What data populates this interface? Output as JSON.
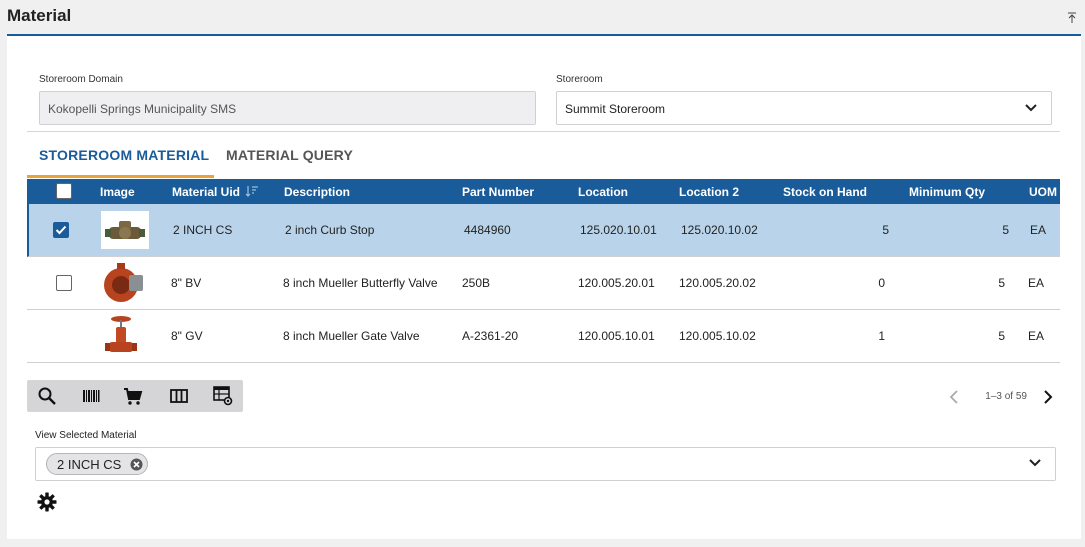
{
  "header": {
    "title": "Material"
  },
  "filters": {
    "domain_label": "Storeroom Domain",
    "domain_value": "Kokopelli Springs Municipality SMS",
    "storeroom_label": "Storeroom",
    "storeroom_value": "Summit Storeroom"
  },
  "tabs": [
    {
      "label": "STOREROOM MATERIAL",
      "active": true
    },
    {
      "label": "MATERIAL QUERY",
      "active": false
    }
  ],
  "table": {
    "columns": [
      "Image",
      "Material Uid",
      "Description",
      "Part Number",
      "Location",
      "Location 2",
      "Stock on Hand",
      "Minimum Qty",
      "UOM"
    ],
    "rows": [
      {
        "checked": true,
        "uid": "2 INCH CS",
        "description": "2 inch Curb Stop",
        "part_number": "4484960",
        "location": "125.020.10.01",
        "location2": "125.020.10.02",
        "stock": "5",
        "min_qty": "5",
        "uom": "EA",
        "image": "curb-stop"
      },
      {
        "checked": false,
        "uid": "8\" BV",
        "description": "8 inch Mueller Butterfly Valve",
        "part_number": "250B",
        "location": "120.005.20.01",
        "location2": "120.005.20.02",
        "stock": "0",
        "min_qty": "5",
        "uom": "EA",
        "image": "butterfly-valve"
      },
      {
        "checked": false,
        "uid": "8\" GV",
        "description": "8 inch Mueller Gate Valve",
        "part_number": "A-2361-20",
        "location": "120.005.10.01",
        "location2": "120.005.10.02",
        "stock": "1",
        "min_qty": "5",
        "uom": "EA",
        "image": "gate-valve"
      }
    ]
  },
  "toolbar": {
    "icons": [
      "search-icon",
      "barcode-icon",
      "cart-icon",
      "columns-icon",
      "table-settings-icon"
    ]
  },
  "pagination": {
    "text": "1–3 of 59"
  },
  "selected_material": {
    "label": "View Selected Material",
    "chip": "2 INCH CS"
  },
  "colors": {
    "primary": "#1a5c99",
    "accent": "#e8a33a",
    "selected_row": "#b9d4ea"
  }
}
